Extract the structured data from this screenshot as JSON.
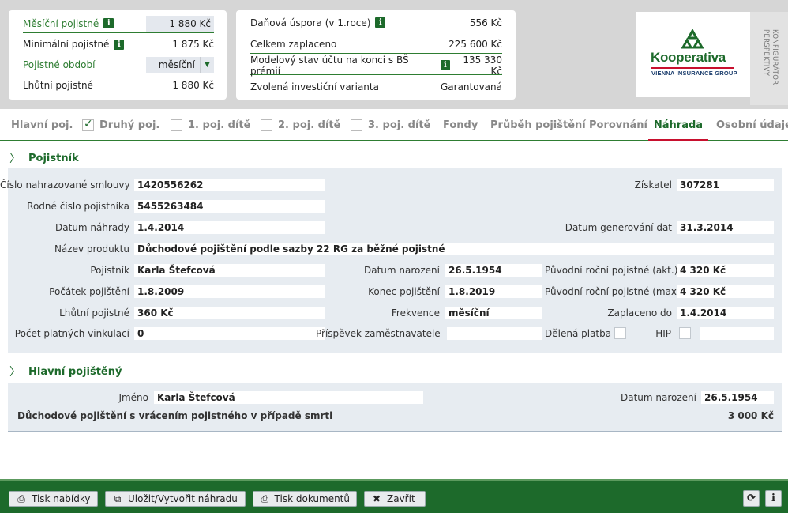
{
  "summary_left": [
    {
      "label": "Měsíční pojistné",
      "value": "1 880 Kč",
      "info": true
    },
    {
      "label": "Minimální pojistné",
      "value": "1 875 Kč",
      "info": true
    },
    {
      "label": "Pojistné období",
      "value": "měsíční"
    },
    {
      "label": "Lhůtní pojistné",
      "value": "1 880 Kč"
    }
  ],
  "summary_right": [
    {
      "label": "Daňová úspora (v 1.roce)",
      "value": "556 Kč",
      "info": true
    },
    {
      "label": "Celkem zaplaceno",
      "value": "225 600 Kč"
    },
    {
      "label": "Modelový stav účtu na konci s BŠ prémií",
      "value": "135 330 Kč",
      "info": true
    },
    {
      "label": "Zvolená investiční varianta",
      "value": "Garantovaná"
    }
  ],
  "logo": {
    "name": "Kooperativa",
    "subtitle": "VIENNA INSURANCE GROUP"
  },
  "side_tab": {
    "line1": "KONFIGURÁTOR",
    "line2": "PERSPEKTIVY"
  },
  "tabs": [
    {
      "label": "Hlavní poj."
    },
    {
      "label": "Druhý poj.",
      "checkbox": true,
      "checked": true
    },
    {
      "label": "1. poj. dítě",
      "checkbox": true,
      "checked": false
    },
    {
      "label": "2. poj. dítě",
      "checkbox": true,
      "checked": false
    },
    {
      "label": "3. poj. dítě",
      "checkbox": true,
      "checked": false
    },
    {
      "label": "Fondy"
    },
    {
      "label": "Průběh pojištění"
    },
    {
      "label": "Porovnání"
    },
    {
      "label": "Náhrada",
      "active": true
    },
    {
      "label": "Osobní údaje"
    }
  ],
  "pojistnik": {
    "title": "Pojistník",
    "cislo_smlouvy_label": "Číslo nahrazované smlouvy",
    "cislo_smlouvy": "1420556262",
    "ziskatel_label": "Získatel",
    "ziskatel": "307281",
    "rodne_cislo_label": "Rodné číslo pojistníka",
    "rodne_cislo": "5455263484",
    "datum_nahrady_label": "Datum náhrady",
    "datum_nahrady": "1.4.2014",
    "datum_generovani_label": "Datum generování dat",
    "datum_generovani": "31.3.2014",
    "nazev_produktu_label": "Název produktu",
    "nazev_produktu": "Důchodové pojištění podle sazby 22 RG za běžné pojistné",
    "pojistnik_label": "Pojistník",
    "pojistnik": "Karla Štefcová",
    "datum_narozeni_label": "Datum narození",
    "datum_narozeni": "26.5.1954",
    "puvodni_akt_label": "Původní roční pojistné (akt.)",
    "puvodni_akt": "4 320 Kč",
    "pocatek_label": "Počátek pojištění",
    "pocatek": "1.8.2009",
    "konec_label": "Konec pojištění",
    "konec": "1.8.2019",
    "puvodni_max_label": "Původní roční pojistné (max.)",
    "puvodni_max": "4 320 Kč",
    "lhutni_label": "Lhůtní pojistné",
    "lhutni": "360 Kč",
    "frekvence_label": "Frekvence",
    "frekvence": "měsíční",
    "zaplaceno_label": "Zaplaceno do",
    "zaplaceno": "1.4.2014",
    "vinkulace_label": "Počet platných vinkulací",
    "vinkulace": "0",
    "prispevek_label": "Příspěvek zaměstnavatele",
    "prispevek": "",
    "delena_label": "Dělená platba",
    "hip_label": "HIP",
    "hip": ""
  },
  "hlavni": {
    "title": "Hlavní pojištěný",
    "jmeno_label": "Jméno",
    "jmeno": "Karla Štefcová",
    "datum_narozeni_label": "Datum narození",
    "datum_narozeni": "26.5.1954",
    "produkt": "Důchodové pojištění s vrácením pojistného v případě smrti",
    "castka": "3 000 Kč"
  },
  "footer": {
    "tisk_nabidky": "Tisk nabídky",
    "ulozit": "Uložit/Vytvořit náhradu",
    "tisk_dokumentu": "Tisk dokumentů",
    "zavrit": "Zavřít"
  },
  "colors": {
    "brand_green": "#1d6a2b",
    "accent_red": "#c8102e",
    "panel": "#e7ecf1"
  }
}
